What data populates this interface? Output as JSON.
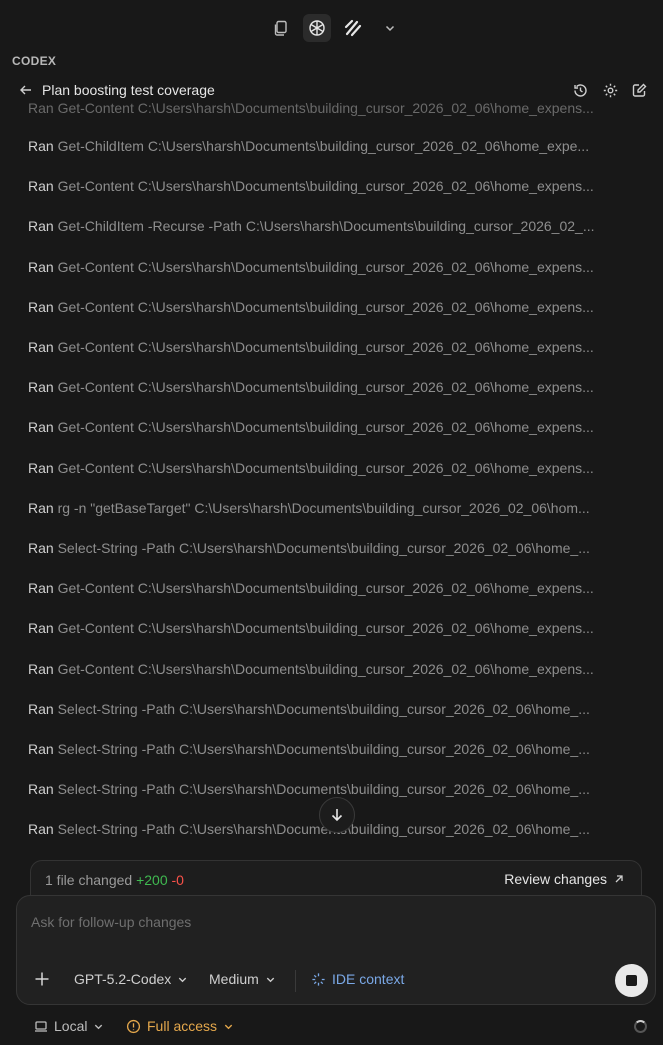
{
  "section_label": "CODEX",
  "header": {
    "title": "Plan boosting test coverage"
  },
  "log": {
    "partial_top": "Ran Get-Content C:\\Users\\harsh\\Documents\\building_cursor_2026_02_06\\home_expens...",
    "rows": [
      {
        "verb": "Ran",
        "cmd": "Get-ChildItem C:\\Users\\harsh\\Documents\\building_cursor_2026_02_06\\home_expe..."
      },
      {
        "verb": "Ran",
        "cmd": "Get-Content C:\\Users\\harsh\\Documents\\building_cursor_2026_02_06\\home_expens..."
      },
      {
        "verb": "Ran",
        "cmd": "Get-ChildItem -Recurse -Path C:\\Users\\harsh\\Documents\\building_cursor_2026_02_..."
      },
      {
        "verb": "Ran",
        "cmd": "Get-Content C:\\Users\\harsh\\Documents\\building_cursor_2026_02_06\\home_expens..."
      },
      {
        "verb": "Ran",
        "cmd": "Get-Content C:\\Users\\harsh\\Documents\\building_cursor_2026_02_06\\home_expens..."
      },
      {
        "verb": "Ran",
        "cmd": "Get-Content C:\\Users\\harsh\\Documents\\building_cursor_2026_02_06\\home_expens..."
      },
      {
        "verb": "Ran",
        "cmd": "Get-Content C:\\Users\\harsh\\Documents\\building_cursor_2026_02_06\\home_expens..."
      },
      {
        "verb": "Ran",
        "cmd": "Get-Content C:\\Users\\harsh\\Documents\\building_cursor_2026_02_06\\home_expens..."
      },
      {
        "verb": "Ran",
        "cmd": "Get-Content C:\\Users\\harsh\\Documents\\building_cursor_2026_02_06\\home_expens..."
      },
      {
        "verb": "Ran",
        "cmd": "rg -n \"getBaseTarget\" C:\\Users\\harsh\\Documents\\building_cursor_2026_02_06\\hom..."
      },
      {
        "verb": "Ran",
        "cmd": "Select-String -Path C:\\Users\\harsh\\Documents\\building_cursor_2026_02_06\\home_..."
      },
      {
        "verb": "Ran",
        "cmd": "Get-Content C:\\Users\\harsh\\Documents\\building_cursor_2026_02_06\\home_expens..."
      },
      {
        "verb": "Ran",
        "cmd": "Get-Content C:\\Users\\harsh\\Documents\\building_cursor_2026_02_06\\home_expens..."
      },
      {
        "verb": "Ran",
        "cmd": "Get-Content C:\\Users\\harsh\\Documents\\building_cursor_2026_02_06\\home_expens..."
      },
      {
        "verb": "Ran",
        "cmd": "Select-String -Path C:\\Users\\harsh\\Documents\\building_cursor_2026_02_06\\home_..."
      },
      {
        "verb": "Ran",
        "cmd": "Select-String -Path C:\\Users\\harsh\\Documents\\building_cursor_2026_02_06\\home_..."
      },
      {
        "verb": "Ran",
        "cmd": "Select-String -Path C:\\Users\\harsh\\Documents\\building_cursor_2026_02_06\\home_..."
      },
      {
        "verb": "Ran",
        "cmd": "Select-String -Path C:\\Users\\harsh\\Documents\\building_cursor_2026_02_06\\home_..."
      }
    ]
  },
  "changes": {
    "summary": "1 file changed",
    "additions": "+200",
    "deletions": "-0",
    "review_label": "Review changes"
  },
  "composer": {
    "placeholder": "Ask for follow-up changes",
    "model": "GPT-5.2-Codex",
    "reasoning": "Medium",
    "ide_context": "IDE context"
  },
  "footer": {
    "location": "Local",
    "access": "Full access"
  },
  "colors": {
    "background": "#181818",
    "additions": "#3fb950",
    "deletions": "#f85149",
    "warning": "#e5a84c",
    "ide_accent": "#7aa8e6"
  },
  "icons": [
    "copy-icon",
    "openai-logo-icon",
    "agent-logo-icon",
    "chevron-down-icon",
    "back-arrow-icon",
    "history-icon",
    "gear-icon",
    "edit-icon",
    "arrow-down-icon",
    "external-arrow-icon",
    "plus-icon",
    "sparkle-icon",
    "stop-icon",
    "laptop-icon",
    "warning-icon",
    "spinner-icon"
  ]
}
